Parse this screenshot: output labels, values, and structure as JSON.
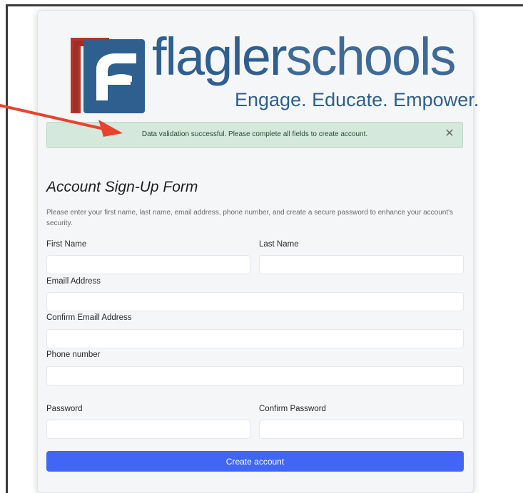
{
  "logo": {
    "word_part1": "flagler",
    "word_part2": "schools",
    "tagline": "Engage. Educate. Empower."
  },
  "alert": {
    "message": "Data validation successful. Please complete all fields to create account.",
    "close_glyph": "✕"
  },
  "form": {
    "title": "Account Sign-Up Form",
    "description": "Please enter your first name, last name, email address, phone number, and create a secure password to enhance your account's security.",
    "fields": {
      "first_name": {
        "label": "First Name",
        "value": ""
      },
      "last_name": {
        "label": "Last Name",
        "value": ""
      },
      "email": {
        "label": "Emaill Address",
        "value": ""
      },
      "confirm_email": {
        "label": "Confirm Emaill Address",
        "value": ""
      },
      "phone": {
        "label": "Phone number",
        "value": ""
      },
      "password": {
        "label": "Password",
        "value": ""
      },
      "confirm_password": {
        "label": "Confirm Password",
        "value": ""
      }
    },
    "submit_label": "Create account"
  },
  "colors": {
    "brand_blue": "#2f5f8e",
    "brand_red": "#b3362b",
    "alert_bg": "#d4e8dc",
    "button": "#4166f5",
    "arrow": "#e8432d"
  },
  "icons": {
    "close": "close-icon",
    "arrow": "annotation-arrow-icon"
  }
}
